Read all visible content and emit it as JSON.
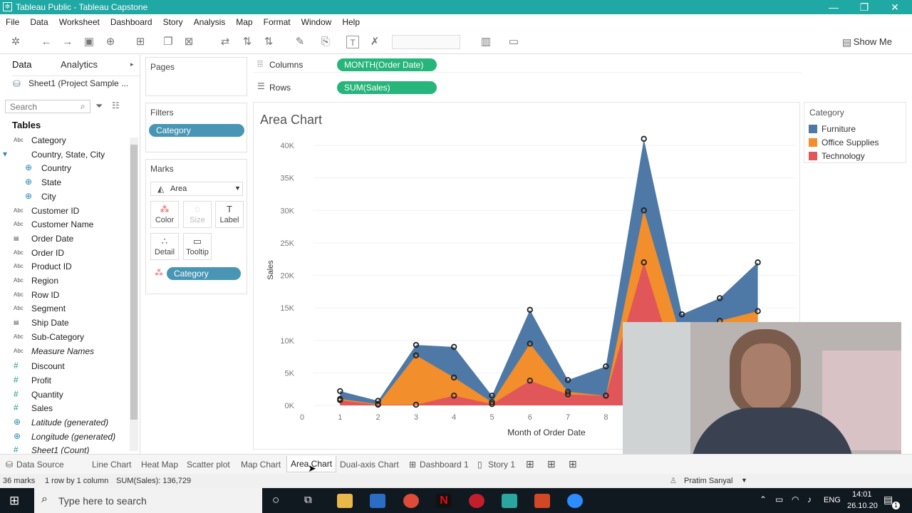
{
  "window": {
    "title": "Tableau Public - Tableau Capstone",
    "minimize": "—",
    "restore": "❐",
    "close": "✕"
  },
  "menu": [
    "File",
    "Data",
    "Worksheet",
    "Dashboard",
    "Story",
    "Analysis",
    "Map",
    "Format",
    "Window",
    "Help"
  ],
  "toolbar": {
    "show_me": "Show Me"
  },
  "data_pane": {
    "tab_data": "Data",
    "tab_analytics": "Analytics",
    "datasource": "Sheet1 (Project Sample ...",
    "search_placeholder": "Search",
    "tables_header": "Tables",
    "fields": [
      {
        "name": "Category",
        "type": "Abc"
      },
      {
        "name": "Country, State, City",
        "type": "hier"
      },
      {
        "name": "Country",
        "type": "geo",
        "indent": true
      },
      {
        "name": "State",
        "type": "geo",
        "indent": true
      },
      {
        "name": "City",
        "type": "geo",
        "indent": true
      },
      {
        "name": "Customer ID",
        "type": "Abc"
      },
      {
        "name": "Customer Name",
        "type": "Abc"
      },
      {
        "name": "Order Date",
        "type": "date"
      },
      {
        "name": "Order ID",
        "type": "Abc"
      },
      {
        "name": "Product ID",
        "type": "Abc"
      },
      {
        "name": "Region",
        "type": "Abc"
      },
      {
        "name": "Row ID",
        "type": "Abc"
      },
      {
        "name": "Segment",
        "type": "Abc"
      },
      {
        "name": "Ship Date",
        "type": "date"
      },
      {
        "name": "Sub-Category",
        "type": "Abc"
      },
      {
        "name": "Measure Names",
        "type": "Abc",
        "italic": true
      },
      {
        "name": "Discount",
        "type": "#"
      },
      {
        "name": "Profit",
        "type": "#"
      },
      {
        "name": "Quantity",
        "type": "#"
      },
      {
        "name": "Sales",
        "type": "#"
      },
      {
        "name": "Latitude (generated)",
        "type": "geo",
        "italic": true
      },
      {
        "name": "Longitude (generated)",
        "type": "geo",
        "italic": true
      },
      {
        "name": "Sheet1 (Count)",
        "type": "#",
        "italic": true
      }
    ]
  },
  "pages": {
    "title": "Pages"
  },
  "filters": {
    "title": "Filters",
    "pill": "Category"
  },
  "marks": {
    "title": "Marks",
    "type": "Area",
    "color": "Color",
    "size": "Size",
    "label": "Label",
    "detail": "Detail",
    "tooltip": "Tooltip",
    "pill": "Category"
  },
  "shelves": {
    "columns_label": "Columns",
    "columns_pill": "MONTH(Order Date)",
    "rows_label": "Rows",
    "rows_pill": "SUM(Sales)"
  },
  "legend": {
    "title": "Category",
    "items": [
      {
        "name": "Furniture",
        "color": "#4e79a7"
      },
      {
        "name": "Office Supplies",
        "color": "#f28e2b"
      },
      {
        "name": "Technology",
        "color": "#e15759"
      }
    ]
  },
  "chart_data": {
    "type": "area",
    "title": "Area Chart",
    "xlabel": "Month of Order Date",
    "ylabel": "Sales",
    "x_ticks": [
      "0",
      "1",
      "2",
      "3",
      "4",
      "5",
      "6",
      "7",
      "8"
    ],
    "y_ticks": [
      "0K",
      "5K",
      "10K",
      "15K",
      "20K",
      "25K",
      "30K",
      "35K",
      "40K"
    ],
    "ylim": [
      0,
      40000
    ],
    "stacked": true,
    "x": [
      1,
      2,
      3,
      4,
      5,
      6,
      7,
      8,
      9,
      10,
      11,
      12
    ],
    "series": [
      {
        "name": "Technology",
        "color": "#e15759",
        "values": [
          800,
          100,
          100,
          1500,
          200,
          3800,
          1700,
          1500,
          22000,
          3000,
          5000,
          5500
        ]
      },
      {
        "name": "Office Supplies",
        "color": "#f28e2b",
        "values": [
          200,
          100,
          7600,
          2800,
          300,
          5700,
          400,
          0,
          8000,
          7000,
          8000,
          9000
        ]
      },
      {
        "name": "Furniture",
        "color": "#4e79a7",
        "values": [
          1200,
          500,
          1600,
          4700,
          1000,
          5200,
          1800,
          4500,
          11000,
          4000,
          3500,
          7500
        ]
      }
    ]
  },
  "sheet_tabs": [
    "Data Source",
    "Line Chart",
    "Heat Map",
    "Scatter plot",
    "Map Chart",
    "Area Chart",
    "Dual-axis Chart",
    "Dashboard 1",
    "Story 1"
  ],
  "status": {
    "marks": "36 marks",
    "rows": "1 row by 1 column",
    "sum": "SUM(Sales): 136,729",
    "user": "Pratim Sanyal"
  },
  "taskbar": {
    "search_placeholder": "Type here to search",
    "lang": "ENG",
    "time": "14:01",
    "date": "26.10.20",
    "notif": "1"
  }
}
